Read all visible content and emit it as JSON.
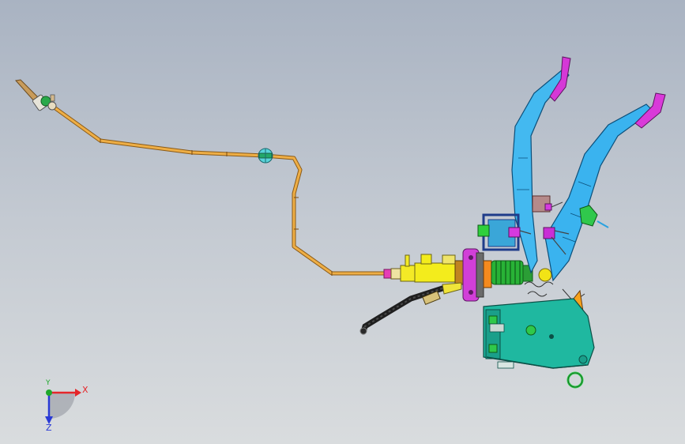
{
  "viewport": {
    "background_top": "#a9b3c2",
    "background_bottom": "#d9dcde"
  },
  "model": {
    "tube_color": "#e9a63a",
    "pedal_color": "#3fb6ee",
    "bracket_color": "#1fb39d",
    "magenta_color": "#d63adf",
    "cylinder_color": "#f1ea16",
    "green_color": "#2fc84a"
  },
  "triad": {
    "x_label": "X",
    "y_label": "Y",
    "z_label": "Z",
    "x_color": "#e5262a",
    "y_color": "#1fa82c",
    "z_color": "#2a3ad6"
  }
}
